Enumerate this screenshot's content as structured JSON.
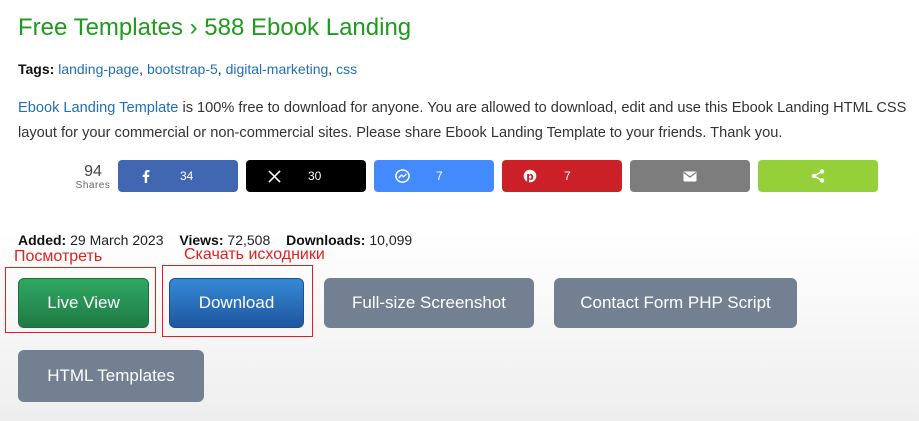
{
  "page": {
    "title": "Free Templates › 588 Ebook Landing"
  },
  "tags": {
    "label": "Tags:",
    "items": [
      "landing-page",
      "bootstrap-5",
      "digital-marketing",
      "css"
    ]
  },
  "description": {
    "link_text": "Ebook Landing Template",
    "text": " is 100% free to download for anyone. You are allowed to download, edit and use this Ebook Landing HTML CSS layout for your commercial or non-commercial sites. Please share Ebook Landing Template to your friends. Thank you."
  },
  "share": {
    "total": "94",
    "total_label": "Shares",
    "buttons": [
      {
        "icon": "facebook-icon",
        "count": "34",
        "color": "#4267b2"
      },
      {
        "icon": "x-icon",
        "count": "30",
        "color": "#000000"
      },
      {
        "icon": "messenger-icon",
        "count": "7",
        "color": "#448aff"
      },
      {
        "icon": "pinterest-icon",
        "count": "7",
        "color": "#cb2027"
      },
      {
        "icon": "email-icon",
        "count": "",
        "color": "#7d7d7d"
      },
      {
        "icon": "share-icon",
        "count": "",
        "color": "#95d03a"
      }
    ]
  },
  "stats": {
    "added_label": "Added:",
    "added_value": "29 March 2023",
    "views_label": "Views:",
    "views_value": "72,508",
    "downloads_label": "Downloads:",
    "downloads_value": "10,099"
  },
  "annotations": {
    "view_note": "Посмотреть",
    "download_note": "Скачать исходники",
    "color": "#e0201f"
  },
  "buttons": {
    "live_view": "Live View",
    "download": "Download",
    "screenshot": "Full-size Screenshot",
    "contact_form": "Contact Form PHP Script",
    "html_templates": "HTML Templates"
  }
}
